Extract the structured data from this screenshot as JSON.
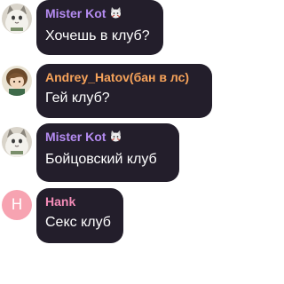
{
  "colors": {
    "bubble_bg": "#231e2b",
    "message_text": "#ffffff",
    "name_mister_kot": "#b58cf2",
    "name_andrey": "#f7a35a",
    "name_hank": "#f58cb8",
    "hank_avatar_bg": "#f7a3b1"
  },
  "messages": [
    {
      "author": "Mister Kot",
      "author_badge_icon": "cat-emoji-icon",
      "text": "Хочешь в клуб?",
      "avatar_icon": "anime-cat-avatar-icon"
    },
    {
      "author": "Andrey_Hatov(бан в лс)",
      "text": "Гей клуб?",
      "avatar_icon": "anime-character-avatar-icon"
    },
    {
      "author": "Mister Kot",
      "author_badge_icon": "cat-emoji-icon",
      "text": "Бойцовский клуб",
      "avatar_icon": "anime-cat-avatar-icon"
    },
    {
      "author": "Hank",
      "text": "Секс клуб",
      "avatar_letter": "H"
    }
  ]
}
